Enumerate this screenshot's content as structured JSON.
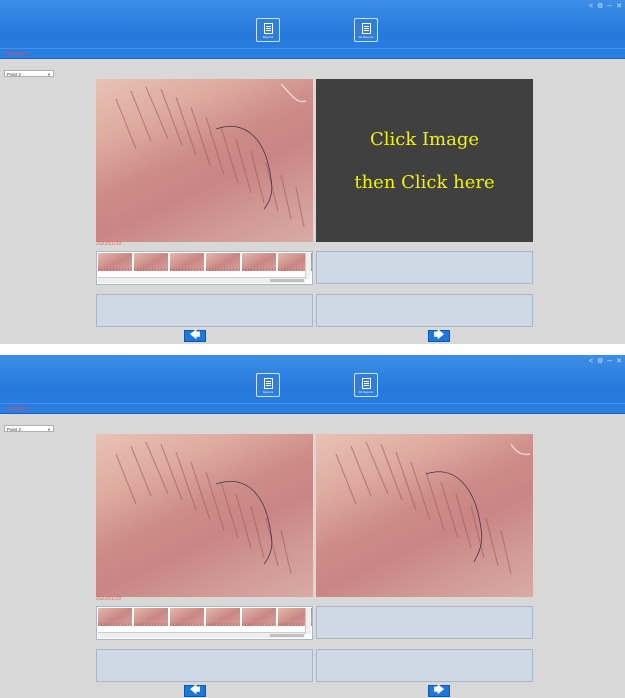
{
  "screens": [
    {
      "win_controls": "< ⚙ ─ ✕",
      "toolbar": {
        "button1_label": "Reports",
        "button2_label": "All Reports"
      },
      "red_label": "Customer",
      "dropdown_value": "Point 2",
      "placeholder_lines": [
        "Click Image",
        "then Click here"
      ],
      "date_label": "2022/01/29",
      "nav": {
        "prev": "🡄",
        "next": "🡆"
      }
    },
    {
      "win_controls": "< ⚙ ─ ✕",
      "toolbar": {
        "button1_label": "Reports",
        "button2_label": "All Reports"
      },
      "red_label": "Customer",
      "dropdown_value": "Point 2",
      "date_label": "2022/01/29",
      "nav": {
        "prev": "🡄",
        "next": "🡆"
      }
    }
  ],
  "icons": [
    "report-icon",
    "all-reports-icon",
    "arrow-left-icon",
    "arrow-right-icon",
    "chevron-down-icon"
  ]
}
